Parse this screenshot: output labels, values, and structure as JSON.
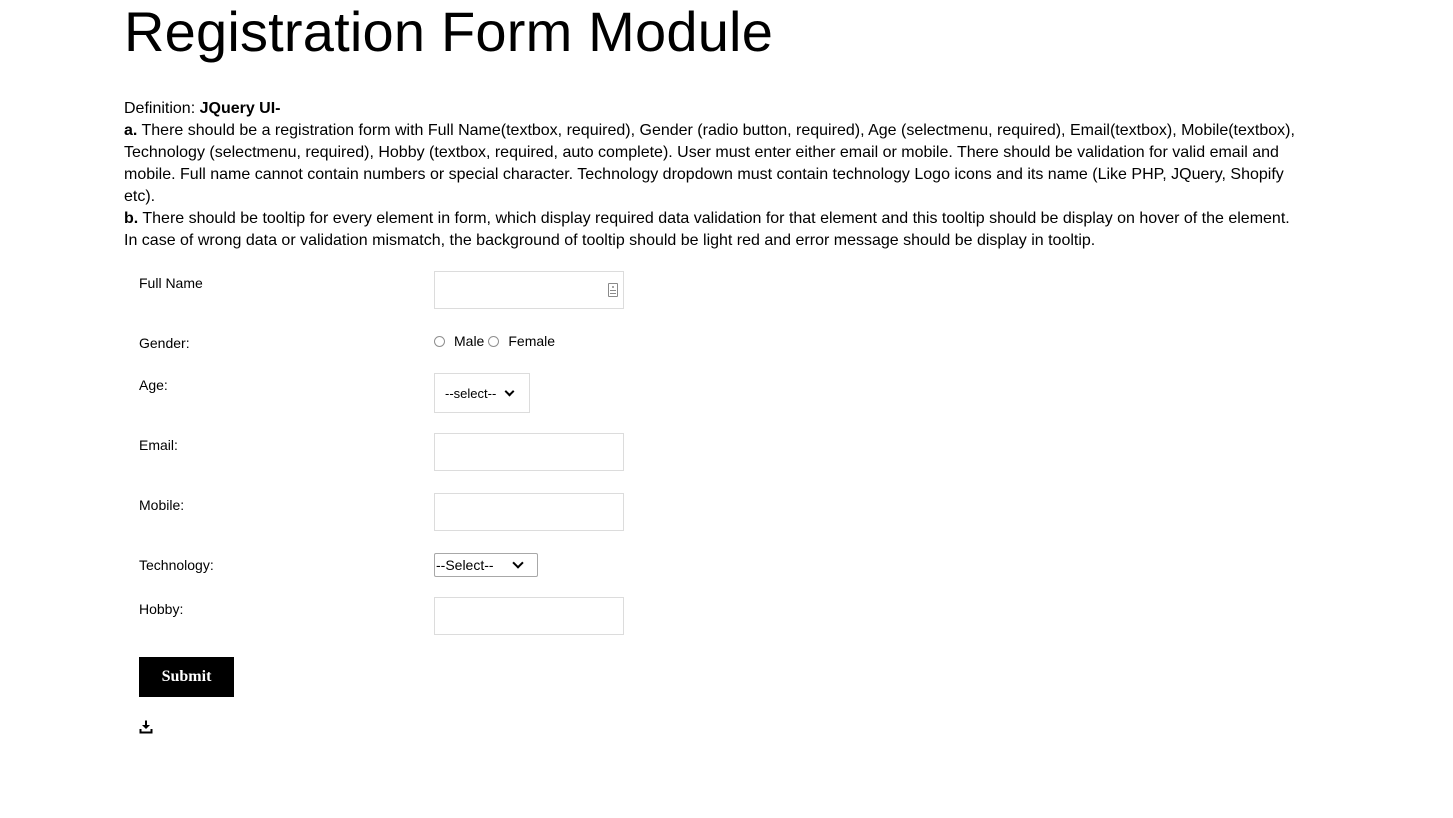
{
  "page": {
    "title": "Registration Form Module"
  },
  "definition": {
    "prefix": "Definition: ",
    "heading": "JQuery UI-",
    "item_a_marker": "a.",
    "item_a_text": " There should be a registration form with Full Name(textbox, required), Gender (radio button, required), Age (selectmenu, required), Email(textbox), Mobile(textbox), Technology (selectmenu, required), Hobby (textbox, required, auto complete). User must enter either email or mobile. There should be validation for valid email and mobile. Full name cannot contain numbers or special character. Technology dropdown must contain technology Logo icons and its name (Like PHP, JQuery, Shopify etc).",
    "item_b_marker": "b.",
    "item_b_text": " There should be tooltip for every element in form, which display required data validation for that element and this tooltip should be display on hover of the element. In case of wrong data or validation mismatch, the background of tooltip should be light red and error message should be display in tooltip."
  },
  "form": {
    "full_name": {
      "label": "Full Name",
      "value": ""
    },
    "gender": {
      "label": "Gender:",
      "options": [
        "Male",
        "Female"
      ],
      "selected": null
    },
    "age": {
      "label": "Age:",
      "selected": "--select--"
    },
    "email": {
      "label": "Email:",
      "value": ""
    },
    "mobile": {
      "label": "Mobile:",
      "value": ""
    },
    "technology": {
      "label": "Technology:",
      "selected": "--Select--"
    },
    "hobby": {
      "label": "Hobby:",
      "value": ""
    },
    "submit_label": "Submit"
  },
  "icons": {
    "full_name_field": "contact-card-icon",
    "bottom": "download-icon"
  }
}
